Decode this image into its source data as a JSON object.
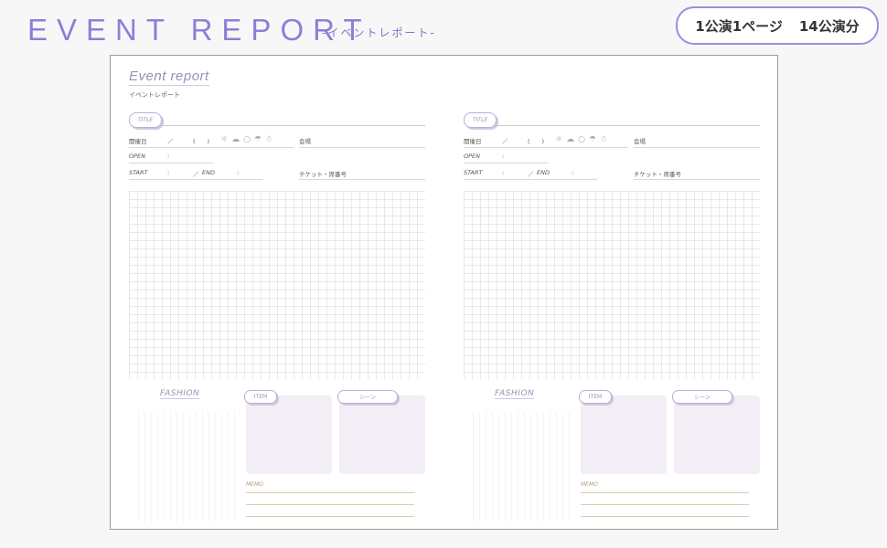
{
  "header": {
    "title": "EVENT REPORT",
    "subtitle": "-イベントレポート-"
  },
  "promo_badge": {
    "left": "1公演1ページ",
    "right": "14公演分"
  },
  "document": {
    "title": "Event report",
    "subtitle": "イベントレポート"
  },
  "page_template": {
    "title_tag": "TITLE",
    "date_label": "開催日",
    "date_slash": "／",
    "date_paren": "(　　)",
    "venue_label": "会場",
    "open_label": "OPEN",
    "colon": ":",
    "start_label": "START",
    "end_label": "END",
    "ticket_label": "チケット・席番号",
    "fashion_label": "FASHION",
    "item_tag": "ITEM",
    "scene_tag": "シーン",
    "memo_label": "MEMO",
    "weather_icons": [
      "sun-icon",
      "cloud-sun-icon",
      "cloud-icon",
      "umbrella-icon",
      "snowman-icon"
    ],
    "weather_glyphs": [
      "☼",
      "☁",
      "○",
      "☂",
      "☃"
    ]
  }
}
